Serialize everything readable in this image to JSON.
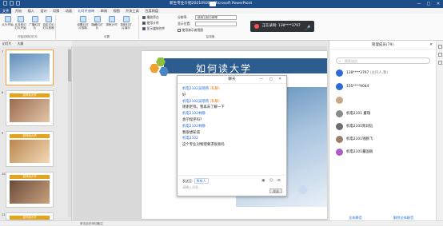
{
  "window": {
    "title": "新生专业介绍20210928 - Microsoft PowerPoint",
    "controls": [
      "—",
      "□",
      "✕"
    ]
  },
  "menu": {
    "items": [
      "文件",
      "开始",
      "插入",
      "设计",
      "切换",
      "动画",
      "幻灯片放映",
      "审阅",
      "视图",
      "开发工具",
      "百度网盘"
    ],
    "active_index": 6
  },
  "ribbon": {
    "start_group": {
      "label": "开始放映幻灯片",
      "buttons": [
        "从头开始",
        "从当前幻灯片开始",
        "广播幻灯片",
        "自定义幻灯片放映"
      ]
    },
    "setup_group": {
      "label": "设置",
      "buttons": [
        "设置幻灯片放映",
        "隐藏幻灯片",
        "排练计时",
        "录制幻灯片演示"
      ]
    },
    "options": [
      "播放旁白",
      "使用计时",
      "显示媒体控件"
    ],
    "monitor_group": {
      "label": "监视器",
      "resolution_label": "分辨率:",
      "resolution_value": "使用当前分辨率",
      "show_on_label": "显示位置:",
      "show_on_value": "",
      "presenter_view": "使用演示者视图"
    }
  },
  "recording": {
    "text": "正在录制: 138****3797"
  },
  "panel_tabs": [
    "幻灯片",
    "大纲"
  ],
  "slides": {
    "numbers": [
      "7",
      "8",
      "9",
      "10",
      "11"
    ],
    "headers": [
      "",
      "如何读大学",
      "如何读大学",
      "如何读大学",
      "如何读大学"
    ]
  },
  "main_slide": {
    "title": "如何读大学"
  },
  "chat": {
    "title": "聊天",
    "messages": [
      {
        "name": "机电2102吴晓燕",
        "tag": "(私聊)",
        "text": "好"
      },
      {
        "name": "机电2102吴晓燕",
        "tag": "(私聊)",
        "text": "谢谢老师。我再去了解一下"
      },
      {
        "name": "机电2102林静",
        "tag": "",
        "text": "会学程序吗?"
      },
      {
        "name": "机电2102林静",
        "tag": "",
        "text": "我很想知道"
      },
      {
        "name": "机电2102",
        "tag": "",
        "text": "这个专业对物理要求很高吗"
      }
    ],
    "send_to_label": "发送至:",
    "send_to_value": "所有人",
    "input_placeholder": "请输入消息...",
    "send_label": "发送"
  },
  "members": {
    "title": "管理成员(79)",
    "search_placeholder": "搜索成员",
    "list": [
      {
        "name": "138****3797",
        "sub": "(主持人,我)"
      },
      {
        "name": "155****9044",
        "sub": ""
      },
      {
        "name": "",
        "sub": ""
      },
      {
        "name": "机电2101 董瑞",
        "sub": ""
      },
      {
        "name": "机电2101陈润恺",
        "sub": ""
      },
      {
        "name": "机电2101钱鹏飞",
        "sub": ""
      },
      {
        "name": "机电2101董国丽",
        "sub": ""
      }
    ],
    "mute_all": "全体静音",
    "unmute_all": "解除全体静音"
  },
  "status": {
    "text": "单击此处添加备注"
  }
}
